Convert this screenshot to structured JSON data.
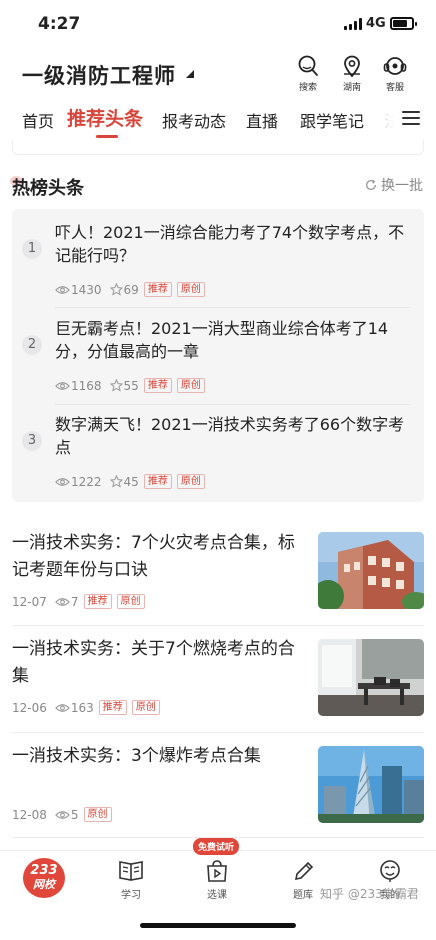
{
  "status_bar": {
    "time": "4:27",
    "network": "4G",
    "battery_level_percent": 80
  },
  "header": {
    "title": "一级消防工程师",
    "actions": [
      {
        "label": "搜索",
        "icon": "search-icon"
      },
      {
        "label": "湖南",
        "icon": "location-icon"
      },
      {
        "label": "客服",
        "icon": "headset-icon"
      }
    ]
  },
  "tabs": [
    {
      "label": "首页",
      "active": false
    },
    {
      "label": "推荐头条",
      "active": true
    },
    {
      "label": "报考动态",
      "active": false
    },
    {
      "label": "直播",
      "active": false
    },
    {
      "label": "跟学笔记",
      "active": false
    },
    {
      "label": "法",
      "active": false
    }
  ],
  "hot_list": {
    "title": "热榜头条",
    "refresh_label": "换一批",
    "items": [
      {
        "rank": "1",
        "title": "吓人！2021一消综合能力考了74个数字考点，不记能行吗？",
        "views": "1430",
        "stars": "69",
        "tags": [
          "推荐",
          "原创"
        ]
      },
      {
        "rank": "2",
        "title": "巨无霸考点！2021一消大型商业综合体考了14分，分值最高的一章",
        "views": "1168",
        "stars": "55",
        "tags": [
          "推荐",
          "原创"
        ]
      },
      {
        "rank": "3",
        "title": "数字满天飞！2021一消技术实务考了66个数字考点",
        "views": "1222",
        "stars": "45",
        "tags": [
          "推荐",
          "原创"
        ]
      }
    ]
  },
  "news": [
    {
      "title": "一消技术实务：7个火灾考点合集，标记考题年份与口诀",
      "date": "12-07",
      "views": "7",
      "tags": [
        "推荐",
        "原创"
      ],
      "image": "building-photo"
    },
    {
      "title": "一消技术实务：关于7个燃烧考点的合集",
      "date": "12-06",
      "views": "163",
      "tags": [
        "推荐",
        "原创"
      ],
      "image": "office-photo"
    },
    {
      "title": "一消技术实务：3个爆炸考点合集",
      "date": "12-08",
      "views": "5",
      "tags": [
        "原创"
      ],
      "image": "skyscraper-photo"
    }
  ],
  "bottom_nav": {
    "logo_line1": "233",
    "logo_line2": "网校",
    "trial_badge": "免费试听",
    "items": [
      {
        "label": "学习",
        "icon": "book-icon"
      },
      {
        "label": "选课",
        "icon": "course-bag-icon"
      },
      {
        "label": "题库",
        "icon": "pencil-icon"
      },
      {
        "label": "我的",
        "icon": "profile-icon"
      }
    ]
  },
  "watermark": "知乎 @233学霸君",
  "colors": {
    "accent": "#d9453a",
    "panel": "#f5f5f6",
    "muted": "#888888"
  }
}
